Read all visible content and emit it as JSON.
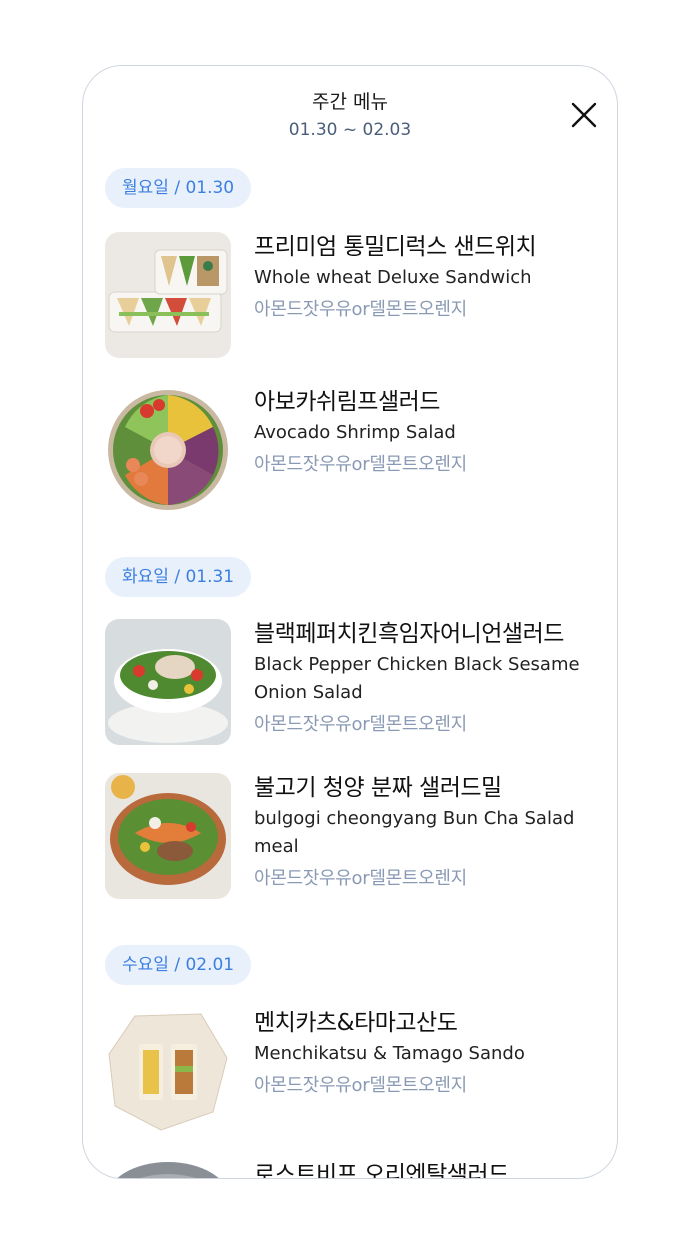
{
  "header": {
    "title": "주간 메뉴",
    "date_range": "01.30 ~ 02.03"
  },
  "days": [
    {
      "label": "월요일 / 01.30",
      "items": [
        {
          "name_ko": "프리미엄 통밀디럭스 샌드위치",
          "name_en": "Whole wheat Deluxe Sandwich",
          "drink": "아몬드잣우유or델몬트오렌지"
        },
        {
          "name_ko": "아보카쉬림프샐러드",
          "name_en": "Avocado Shrimp Salad",
          "drink": "아몬드잣우유or델몬트오렌지"
        }
      ]
    },
    {
      "label": "화요일 / 01.31",
      "items": [
        {
          "name_ko": "블랙페퍼치킨흑임자어니언샐러드",
          "name_en": "Black Pepper Chicken Black Sesame Onion Salad",
          "drink": "아몬드잣우유or델몬트오렌지"
        },
        {
          "name_ko": "불고기 청양 분짜 샐러드밀",
          "name_en": "bulgogi cheongyang Bun Cha Salad meal",
          "drink": "아몬드잣우유or델몬트오렌지"
        }
      ]
    },
    {
      "label": "수요일 / 02.01",
      "items": [
        {
          "name_ko": "멘치카츠&타마고산도",
          "name_en": "Menchikatsu & Tamago Sando",
          "drink": "아몬드잣우유or델몬트오렌지"
        },
        {
          "name_ko": "로스트비프 오리엔탈샐러드",
          "name_en": "",
          "drink": ""
        }
      ]
    }
  ],
  "icons": {
    "close": "close-icon"
  },
  "colors": {
    "badge_bg": "#e7f0fb",
    "badge_text": "#3d7fe0",
    "drink_text": "#8a9ab4",
    "subtitle_text": "#4a5e7a"
  }
}
